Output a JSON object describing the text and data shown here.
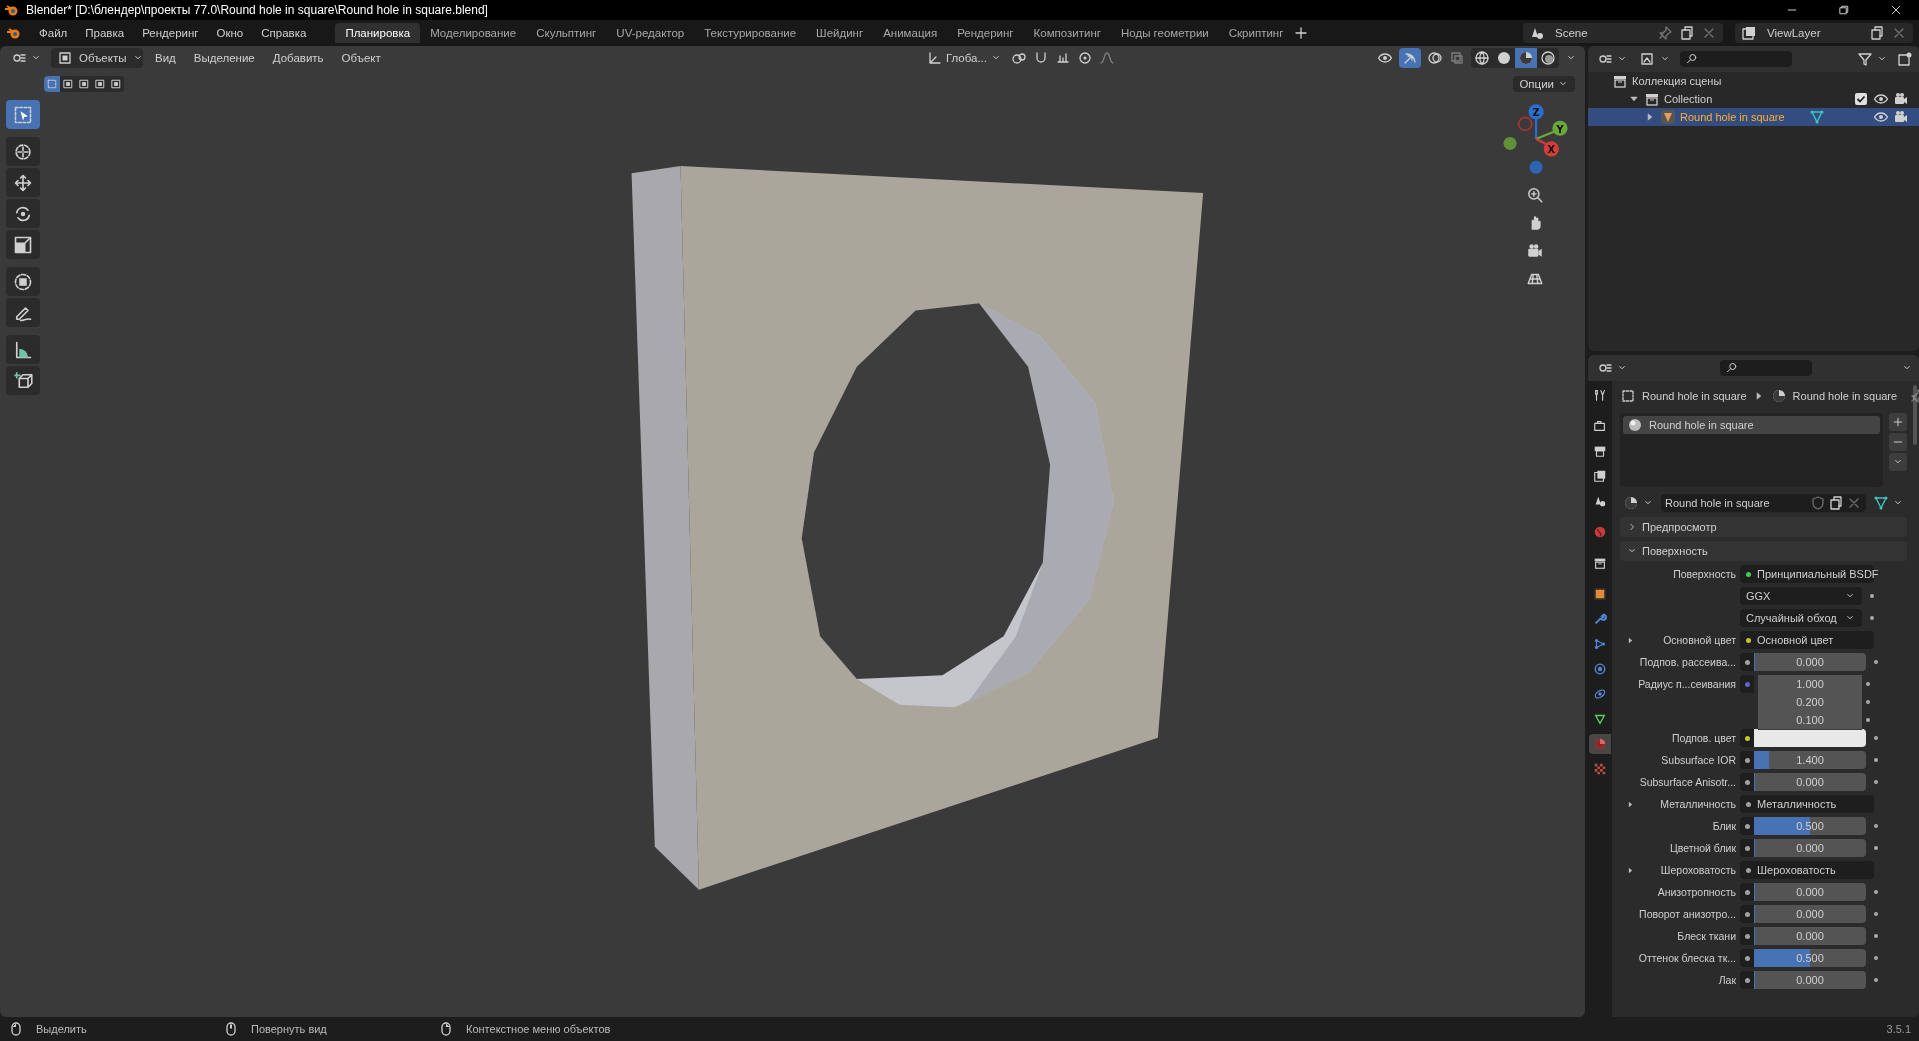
{
  "title": "Blender* [D:\\блендер\\проекты 77.0\\Round hole in square\\Round hole in square.blend]",
  "menu": [
    "Файл",
    "Правка",
    "Рендеринг",
    "Окно",
    "Справка"
  ],
  "workspaces": [
    {
      "label": "Планировка",
      "selected": true
    },
    {
      "label": "Моделирование",
      "selected": false
    },
    {
      "label": "Скульптинг",
      "selected": false
    },
    {
      "label": "UV-редактор",
      "selected": false
    },
    {
      "label": "Текстурирование",
      "selected": false
    },
    {
      "label": "Шейдинг",
      "selected": false
    },
    {
      "label": "Анимация",
      "selected": false
    },
    {
      "label": "Рендеринг",
      "selected": false
    },
    {
      "label": "Композитинг",
      "selected": false
    },
    {
      "label": "Ноды геометрии",
      "selected": false
    },
    {
      "label": "Скриптинг",
      "selected": false
    }
  ],
  "scene": "Scene",
  "view_layer": "ViewLayer",
  "viewport": {
    "mode": "Объекты",
    "menus": [
      "Вид",
      "Выделение",
      "Добавить",
      "Объект"
    ],
    "orientation": "Глоба...",
    "options": "Опции",
    "select_modes": [
      {
        "selected": true
      },
      {
        "selected": false
      },
      {
        "selected": false
      },
      {
        "selected": false
      },
      {
        "selected": false
      }
    ],
    "shading": [
      {
        "kind": "wireframe",
        "selected": false
      },
      {
        "kind": "solid",
        "selected": false
      },
      {
        "kind": "material",
        "selected": true
      },
      {
        "kind": "rendered",
        "selected": false
      }
    ],
    "tools": [
      {
        "kind": "select",
        "selected": true
      },
      {
        "kind": "cursor",
        "selected": false
      },
      {
        "kind": "move",
        "selected": false
      },
      {
        "kind": "rotate",
        "selected": false
      },
      {
        "kind": "scale",
        "selected": false
      },
      {
        "kind": "transform",
        "selected": false
      },
      {
        "kind": "annotate",
        "selected": false
      },
      {
        "kind": "measure",
        "selected": false
      },
      {
        "kind": "add-cube",
        "selected": false
      }
    ],
    "gizmo": {
      "z": "Z",
      "y": "Y",
      "x": "X"
    }
  },
  "outliner": {
    "tree": [
      {
        "label": "Коллекция сцены",
        "kind": "scene",
        "selected": false,
        "children": [
          {
            "label": "Collection",
            "kind": "collection",
            "selected": false,
            "expanded": true,
            "checked": true,
            "children": [
              {
                "label": "Round hole in square",
                "kind": "object",
                "selected": true,
                "expanded": false
              }
            ]
          }
        ]
      }
    ]
  },
  "properties": {
    "tabs": [
      {
        "kind": "tool",
        "selected": false
      },
      {
        "kind": "render",
        "selected": false
      },
      {
        "kind": "output",
        "selected": false
      },
      {
        "kind": "view-layer",
        "selected": false
      },
      {
        "kind": "scene",
        "selected": false
      },
      {
        "kind": "world",
        "selected": false
      },
      {
        "kind": "collection",
        "selected": false
      },
      {
        "kind": "object",
        "selected": false
      },
      {
        "kind": "modifier",
        "selected": false
      },
      {
        "kind": "particles",
        "selected": false
      },
      {
        "kind": "physics",
        "selected": false
      },
      {
        "kind": "constraints",
        "selected": false
      },
      {
        "kind": "data",
        "selected": false
      },
      {
        "kind": "material",
        "selected": true
      },
      {
        "kind": "texture",
        "selected": false
      }
    ],
    "breadcrumb": [
      "Round hole in square",
      "Round hole in square"
    ],
    "slots": [
      {
        "label": "Round hole in square",
        "selected": true
      }
    ],
    "material": "Round hole in square",
    "panels": [
      {
        "label": "Предпросмотр",
        "expanded": false
      },
      {
        "label": "Поверхность",
        "expanded": true,
        "rows": [
          {
            "kind": "link",
            "label": "Поверхность",
            "value": "Принципиальный BSDF",
            "color": "#3ecf4e"
          },
          {
            "kind": "dropdown",
            "value": "GGX"
          },
          {
            "kind": "dropdown",
            "value": "Случайный обход"
          },
          {
            "kind": "group",
            "label": "Основной цвет",
            "value": "Основной цвет",
            "color": "#c7c729",
            "expanded": false
          },
          {
            "kind": "number",
            "label": "Подпов. рассеива...",
            "value": "0.000",
            "level": 0,
            "color": "#a1a1a1"
          },
          {
            "kind": "vector",
            "label": "Радиус п...сеивания",
            "values": [
              "1.000",
              "0.200",
              "0.100"
            ],
            "color": "#6363c7"
          },
          {
            "kind": "swatch",
            "label": "Подпов. цвет",
            "color": "#c7c729",
            "swatch": {
              "color": "#e8e8e8"
            }
          },
          {
            "kind": "number",
            "label": "Subsurface IOR",
            "value": "1.400",
            "level": 0.13,
            "color": "#a1a1a1"
          },
          {
            "kind": "number",
            "label": "Subsurface Anisotr...",
            "value": "0.000",
            "level": 0,
            "color": "#a1a1a1"
          },
          {
            "kind": "group",
            "label": "Металличность",
            "value": "Металличность",
            "color": "#a1a1a1",
            "expanded": false
          },
          {
            "kind": "number",
            "label": "Блик",
            "value": "0.500",
            "level": 0.5,
            "color": "#a1a1a1"
          },
          {
            "kind": "number",
            "label": "Цветной блик",
            "value": "0.000",
            "level": 0,
            "color": "#a1a1a1"
          },
          {
            "kind": "group",
            "label": "Шероховатость",
            "value": "Шероховатость",
            "color": "#a1a1a1",
            "expanded": false
          },
          {
            "kind": "number",
            "label": "Анизотропность",
            "value": "0.000",
            "level": 0,
            "color": "#a1a1a1"
          },
          {
            "kind": "number",
            "label": "Поворот анизотро...",
            "value": "0.000",
            "level": 0,
            "color": "#a1a1a1"
          },
          {
            "kind": "number",
            "label": "Блеск ткани",
            "value": "0.000",
            "level": 0,
            "color": "#a1a1a1"
          },
          {
            "kind": "number",
            "label": "Оттенок блеска тк...",
            "value": "0.500",
            "level": 0.5,
            "color": "#a1a1a1"
          },
          {
            "kind": "number",
            "label": "Лак",
            "value": "0.000",
            "level": 0,
            "color": "#a1a1a1"
          }
        ]
      }
    ]
  },
  "status": {
    "hints": [
      {
        "kind": "left",
        "label": "Выделить"
      },
      {
        "kind": "middle",
        "label": "Повернуть вид"
      },
      {
        "kind": "right",
        "label": "Контекстное меню объектов"
      }
    ],
    "version": "3.5.1"
  }
}
